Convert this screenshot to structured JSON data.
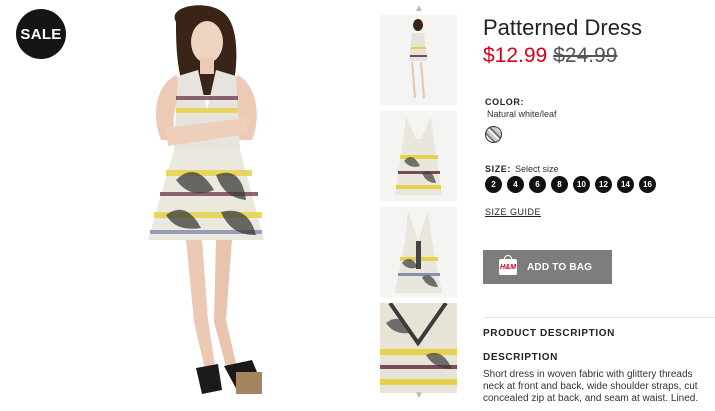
{
  "badge": {
    "sale": "SALE"
  },
  "product": {
    "title": "Patterned Dress",
    "price_sale": "$12.99",
    "price_original": "$24.99"
  },
  "color": {
    "label": "COLOR:",
    "value": "Natural white/leaf"
  },
  "size": {
    "label": "SIZE:",
    "hint": "Select size",
    "options": [
      "2",
      "4",
      "6",
      "8",
      "10",
      "12",
      "14",
      "16"
    ],
    "guide": "SIZE GUIDE"
  },
  "cart": {
    "button_label": "ADD TO BAG",
    "icon_text": "H&M"
  },
  "thumbnails": {
    "up_arrow": "▲",
    "down_arrow": "▼"
  },
  "sections": {
    "product_description": "PRODUCT DESCRIPTION",
    "description_heading": "DESCRIPTION",
    "description_lines": [
      "Short dress in woven fabric with glittery threads",
      "neck at front and back, wide shoulder straps, cut",
      "concealed zip at back, and seam at waist. Lined."
    ]
  },
  "colors": {
    "accent": "#d6001c",
    "button": "#7d7d7d",
    "badge": "#151515"
  }
}
